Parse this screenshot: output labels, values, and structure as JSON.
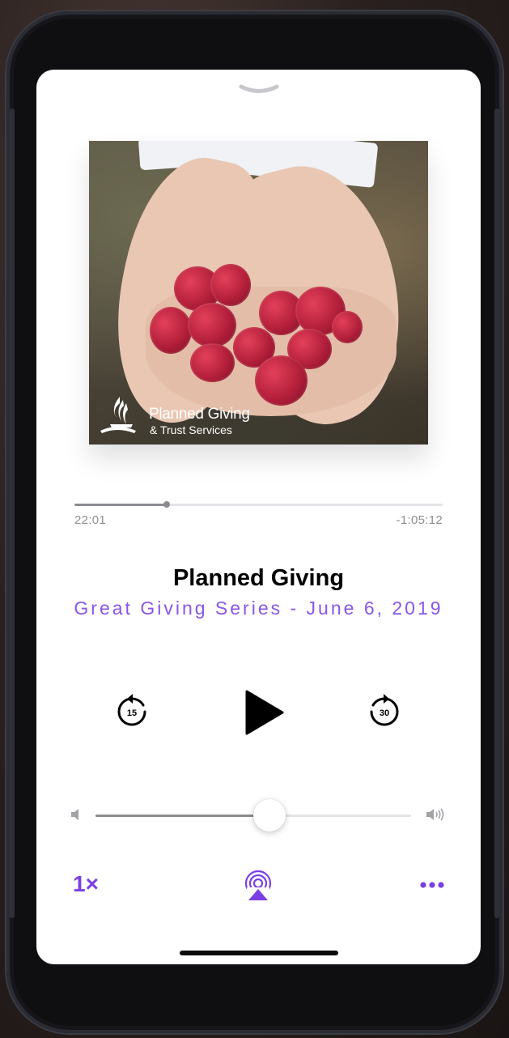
{
  "artwork": {
    "logo_line1": "Planned Giving",
    "logo_line2": "& Trust Services"
  },
  "player": {
    "progress": 0.25,
    "elapsed": "22:01",
    "remaining": "-1:05:12",
    "title": "Planned Giving",
    "subtitle": "Great Giving Series - June 6, 2019",
    "skip_back_seconds": "15",
    "skip_forward_seconds": "30",
    "volume": 0.55,
    "speed": "1×"
  },
  "icons": {
    "grabber": "chevron-down-icon",
    "skip_back": "skip-back-15-icon",
    "play": "play-icon",
    "skip_forward": "skip-forward-30-icon",
    "volume_min": "speaker-low-icon",
    "volume_max": "speaker-high-icon",
    "airplay": "airplay-icon",
    "more": "more-icon"
  },
  "colors": {
    "accent": "#7b3fe4",
    "subtitle": "#8a56e8",
    "track": "#e3e3e7",
    "track_fill": "#8b8b90"
  }
}
